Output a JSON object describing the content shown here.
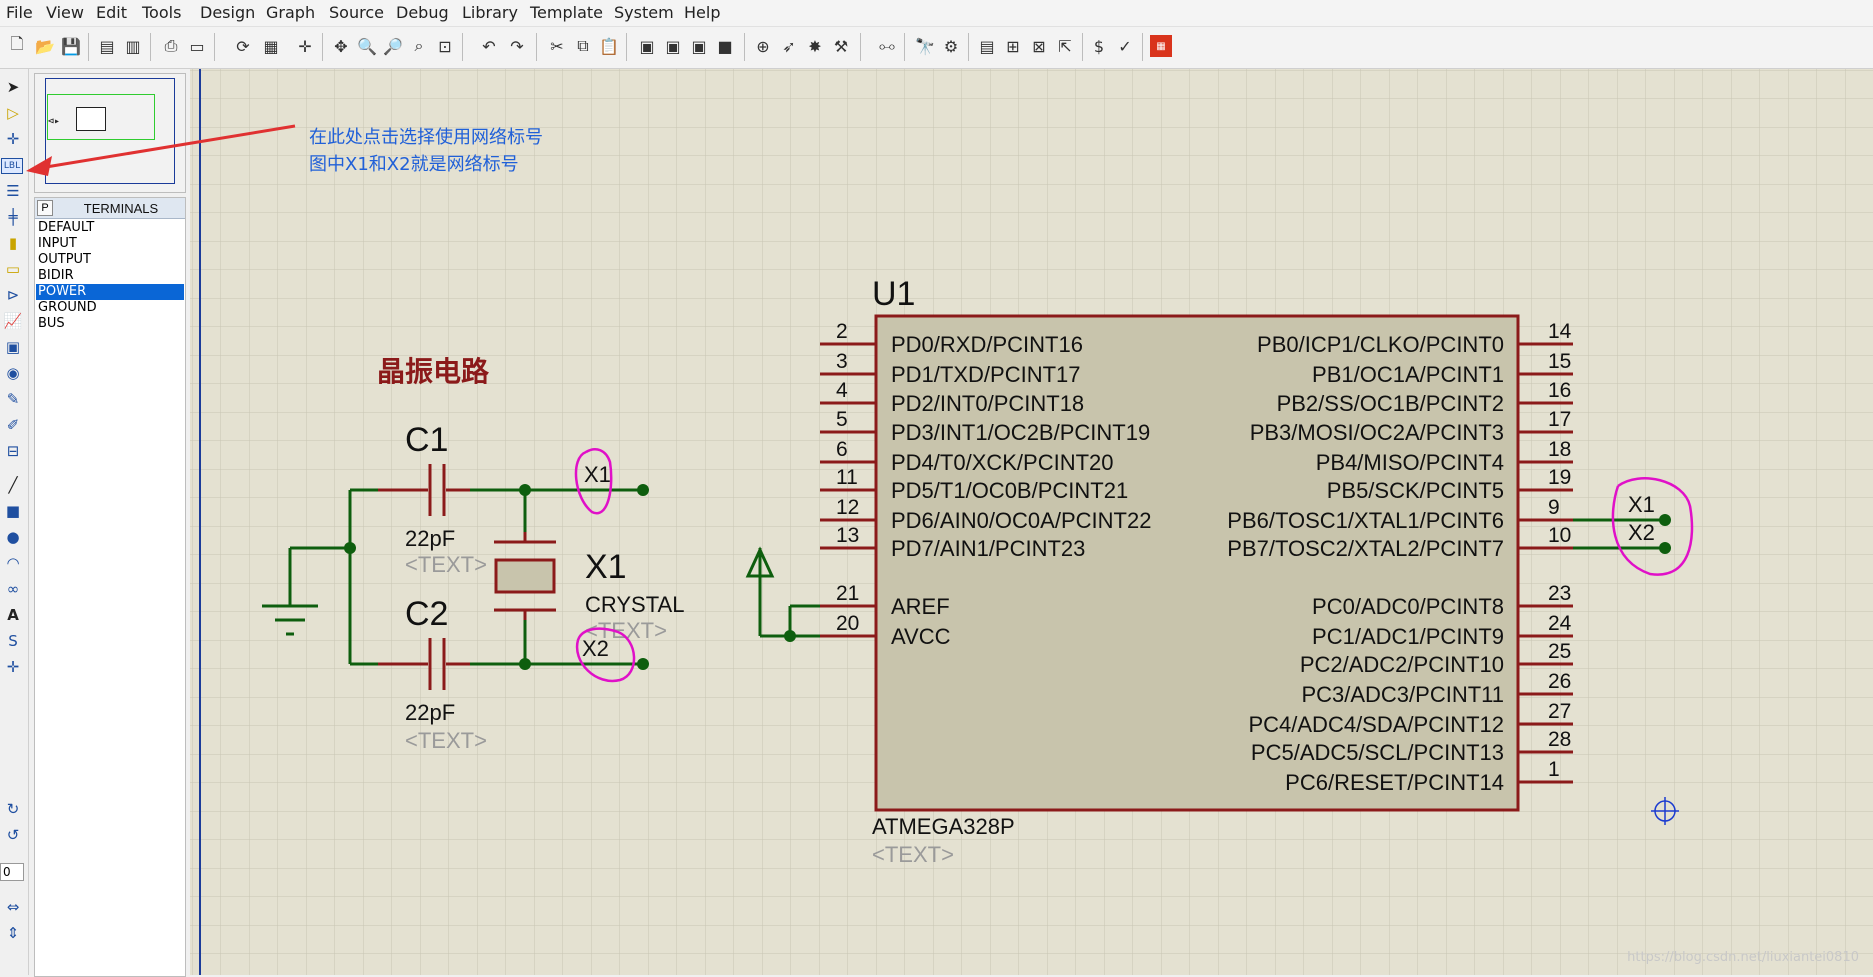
{
  "menu": [
    "File",
    "View",
    "Edit",
    "Tools",
    "Design",
    "Graph",
    "Source",
    "Debug",
    "Library",
    "Template",
    "System",
    "Help"
  ],
  "toolbar_icons": [
    "new-icon",
    "open-icon",
    "save-icon",
    "import-icon",
    "export-icon",
    "print-icon",
    "area-icon",
    "refresh-icon",
    "grid-icon",
    "origin-icon",
    "pan-icon",
    "zoom-in-icon",
    "zoom-out-icon",
    "zoom-all-icon",
    "zoom-area-icon",
    "undo-icon",
    "redo-icon",
    "cut-icon",
    "copy-icon",
    "paste-icon",
    "block-copy-icon",
    "block-move-icon",
    "block-rotate-icon",
    "block-delete-icon",
    "pick-device-icon",
    "make-device-icon",
    "package-tool-icon",
    "decompose-icon",
    "wire-autorouter-icon",
    "search-icon",
    "property-tool-icon",
    "new-sheet-icon",
    "add-sheet-icon",
    "remove-sheet-icon",
    "exit-to-parent-icon",
    "bom-icon",
    "erc-icon",
    "ares-icon"
  ],
  "left_tools": [
    "selection-mode-icon",
    "component-mode-icon",
    "junction-dot-icon",
    "wire-label-icon",
    "text-script-icon",
    "buses-icon",
    "subcircuit-icon",
    "terminals-icon",
    "device-pins-icon",
    "graph-icon",
    "tape-recorder-icon",
    "generator-icon",
    "voltage-probe-icon",
    "current-probe-icon",
    "virtual-instruments-icon",
    "line-icon",
    "box-icon",
    "circle-icon",
    "arc-icon",
    "path-icon",
    "text-icon",
    "symbol-icon",
    "marker-icon",
    "rotate-cw-icon",
    "rotate-ccw-icon",
    "mirror-horizontal-icon",
    "mirror-vertical-icon"
  ],
  "rotation_value": "0",
  "device_panel": {
    "p_button": "P",
    "title": "TERMINALS",
    "items": [
      "DEFAULT",
      "INPUT",
      "OUTPUT",
      "BIDIR",
      "POWER",
      "GROUND",
      "BUS"
    ],
    "selected_index": 4
  },
  "annotation_note": {
    "line1": "在此处点击选择使用网络标号",
    "line2": "图中X1和X2就是网络标号"
  },
  "circuit": {
    "heading": "晶振电路",
    "c1": {
      "ref": "C1",
      "value": "22pF",
      "text": "<TEXT>"
    },
    "c2": {
      "ref": "C2",
      "value": "22pF",
      "text": "<TEXT>"
    },
    "crystal": {
      "ref": "X1",
      "value": "CRYSTAL",
      "text": "<TEXT>"
    },
    "net_labels": [
      "X1",
      "X2"
    ]
  },
  "mcu": {
    "ref": "U1",
    "part": "ATMEGA328P",
    "text": "<TEXT>",
    "left_pins": [
      {
        "num": "2",
        "name": "PD0/RXD/PCINT16"
      },
      {
        "num": "3",
        "name": "PD1/TXD/PCINT17"
      },
      {
        "num": "4",
        "name": "PD2/INT0/PCINT18"
      },
      {
        "num": "5",
        "name": "PD3/INT1/OC2B/PCINT19"
      },
      {
        "num": "6",
        "name": "PD4/T0/XCK/PCINT20"
      },
      {
        "num": "11",
        "name": "PD5/T1/OC0B/PCINT21"
      },
      {
        "num": "12",
        "name": "PD6/AIN0/OC0A/PCINT22"
      },
      {
        "num": "13",
        "name": "PD7/AIN1/PCINT23"
      },
      {
        "num": "21",
        "name": "AREF"
      },
      {
        "num": "20",
        "name": "AVCC"
      }
    ],
    "right_pins": [
      {
        "num": "14",
        "name": "PB0/ICP1/CLKO/PCINT0"
      },
      {
        "num": "15",
        "name": "PB1/OC1A/PCINT1"
      },
      {
        "num": "16",
        "name": "PB2/SS/OC1B/PCINT2"
      },
      {
        "num": "17",
        "name": "PB3/MOSI/OC2A/PCINT3"
      },
      {
        "num": "18",
        "name": "PB4/MISO/PCINT4"
      },
      {
        "num": "19",
        "name": "PB5/SCK/PCINT5"
      },
      {
        "num": "9",
        "name": "PB6/TOSC1/XTAL1/PCINT6"
      },
      {
        "num": "10",
        "name": "PB7/TOSC2/XTAL2/PCINT7"
      },
      {
        "num": "23",
        "name": "PC0/ADC0/PCINT8"
      },
      {
        "num": "24",
        "name": "PC1/ADC1/PCINT9"
      },
      {
        "num": "25",
        "name": "PC2/ADC2/PCINT10"
      },
      {
        "num": "26",
        "name": "PC3/ADC3/PCINT11"
      },
      {
        "num": "27",
        "name": "PC4/ADC4/SDA/PCINT12"
      },
      {
        "num": "28",
        "name": "PC5/ADC5/SCL/PCINT13"
      },
      {
        "num": "1",
        "name": "PC6/RESET/PCINT14"
      }
    ],
    "xtal_labels": [
      "X1",
      "X2"
    ]
  },
  "watermark": "https://blog.csdn.net/liuxiantei0810",
  "colors": {
    "sheet": "#e4e1d1",
    "grid": "#c8c5b4",
    "component_outline": "#8b1a1a",
    "component_fill": "#c8c4ac",
    "wire": "#0e5e0e",
    "note_text": "#2060d8",
    "arrow": "#e03131",
    "highlight": "#e010c8"
  }
}
